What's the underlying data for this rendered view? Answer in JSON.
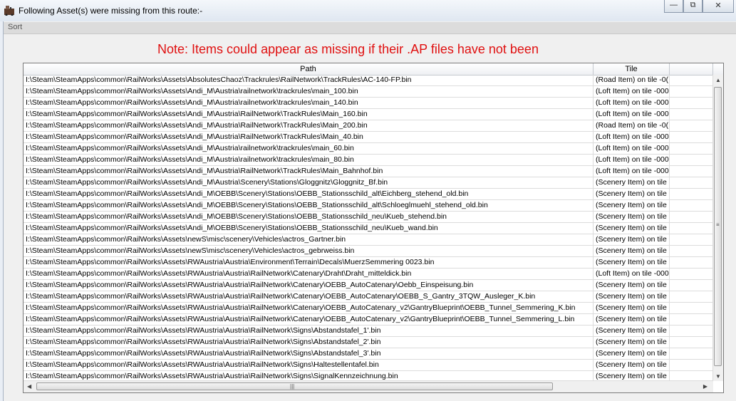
{
  "window": {
    "title": "Following Asset(s) were missing from this route:-",
    "controls": {
      "minimize": "—",
      "maximize": "⧉",
      "close": "✕"
    }
  },
  "menu": {
    "sort_label": "Sort"
  },
  "note": "Note: Items could appear as missing if their .AP files have not been",
  "table": {
    "columns": [
      "Path",
      "Tile",
      ""
    ],
    "rows": [
      {
        "path": "I:\\Steam\\SteamApps\\common\\RailWorks\\Assets\\AbsolutesChaoz\\Trackrules\\RailNetwork\\TrackRules\\AC-140-FP.bin",
        "tile": "(Road Item) on tile -0("
      },
      {
        "path": "I:\\Steam\\SteamApps\\common\\RailWorks\\Assets\\Andi_M\\Austria\\railnetwork\\trackrules\\main_100.bin",
        "tile": "(Loft Item) on tile -000"
      },
      {
        "path": "I:\\Steam\\SteamApps\\common\\RailWorks\\Assets\\Andi_M\\Austria\\railnetwork\\trackrules\\main_140.bin",
        "tile": "(Loft Item) on tile -000"
      },
      {
        "path": "I:\\Steam\\SteamApps\\common\\RailWorks\\Assets\\Andi_M\\Austria\\RailNetwork\\TrackRules\\Main_160.bin",
        "tile": "(Loft Item) on tile -000"
      },
      {
        "path": "I:\\Steam\\SteamApps\\common\\RailWorks\\Assets\\Andi_M\\Austria\\RailNetwork\\TrackRules\\Main_200.bin",
        "tile": "(Road Item) on tile -0("
      },
      {
        "path": "I:\\Steam\\SteamApps\\common\\RailWorks\\Assets\\Andi_M\\Austria\\RailNetwork\\TrackRules\\Main_40.bin",
        "tile": "(Loft Item) on tile -000"
      },
      {
        "path": "I:\\Steam\\SteamApps\\common\\RailWorks\\Assets\\Andi_M\\Austria\\railnetwork\\trackrules\\main_60.bin",
        "tile": "(Loft Item) on tile -000"
      },
      {
        "path": "I:\\Steam\\SteamApps\\common\\RailWorks\\Assets\\Andi_M\\Austria\\railnetwork\\trackrules\\main_80.bin",
        "tile": "(Loft Item) on tile -000"
      },
      {
        "path": "I:\\Steam\\SteamApps\\common\\RailWorks\\Assets\\Andi_M\\Austria\\RailNetwork\\TrackRules\\Main_Bahnhof.bin",
        "tile": "(Loft Item) on tile -000"
      },
      {
        "path": "I:\\Steam\\SteamApps\\common\\RailWorks\\Assets\\Andi_M\\Austria\\Scenery\\Stations\\Gloggnitz\\Gloggnitz_Bf.bin",
        "tile": "(Scenery Item) on tile"
      },
      {
        "path": "I:\\Steam\\SteamApps\\common\\RailWorks\\Assets\\Andi_M\\OEBB\\Scenery\\Stations\\OEBB_Stationsschild_alt\\Eichberg_stehend_old.bin",
        "tile": "(Scenery Item) on tile"
      },
      {
        "path": "I:\\Steam\\SteamApps\\common\\RailWorks\\Assets\\Andi_M\\OEBB\\Scenery\\Stations\\OEBB_Stationsschild_alt\\Schloeglmuehl_stehend_old.bin",
        "tile": "(Scenery Item) on tile"
      },
      {
        "path": "I:\\Steam\\SteamApps\\common\\RailWorks\\Assets\\Andi_M\\OEBB\\Scenery\\Stations\\OEBB_Stationsschild_neu\\Kueb_stehend.bin",
        "tile": "(Scenery Item) on tile"
      },
      {
        "path": "I:\\Steam\\SteamApps\\common\\RailWorks\\Assets\\Andi_M\\OEBB\\Scenery\\Stations\\OEBB_Stationsschild_neu\\Kueb_wand.bin",
        "tile": "(Scenery Item) on tile"
      },
      {
        "path": "I:\\Steam\\SteamApps\\common\\RailWorks\\Assets\\newS\\misc\\scenery\\Vehicles\\actros_Gartner.bin",
        "tile": "(Scenery Item) on tile"
      },
      {
        "path": "I:\\Steam\\SteamApps\\common\\RailWorks\\Assets\\newS\\misc\\scenery\\Vehicles\\actros_gebrweiss.bin",
        "tile": "(Scenery Item) on tile"
      },
      {
        "path": "I:\\Steam\\SteamApps\\common\\RailWorks\\Assets\\RWAustria\\Austria\\Environment\\Terrain\\Decals\\MuerzSemmering 0023.bin",
        "tile": "(Scenery Item) on tile"
      },
      {
        "path": "I:\\Steam\\SteamApps\\common\\RailWorks\\Assets\\RWAustria\\Austria\\RailNetwork\\Catenary\\Draht\\Draht_mitteldick.bin",
        "tile": "(Loft Item) on tile -000"
      },
      {
        "path": "I:\\Steam\\SteamApps\\common\\RailWorks\\Assets\\RWAustria\\Austria\\RailNetwork\\Catenary\\OEBB_AutoCatenary\\Oebb_Einspeisung.bin",
        "tile": "(Scenery Item) on tile"
      },
      {
        "path": "I:\\Steam\\SteamApps\\common\\RailWorks\\Assets\\RWAustria\\Austria\\RailNetwork\\Catenary\\OEBB_AutoCatenary\\OEBB_S_Gantry_3TQW_Ausleger_K.bin",
        "tile": "(Scenery Item) on tile"
      },
      {
        "path": "I:\\Steam\\SteamApps\\common\\RailWorks\\Assets\\RWAustria\\Austria\\RailNetwork\\Catenary\\OEBB_AutoCatenary_v2\\GantryBlueprint\\OEBB_Tunnel_Semmering_K.bin",
        "tile": "(Scenery Item) on tile"
      },
      {
        "path": "I:\\Steam\\SteamApps\\common\\RailWorks\\Assets\\RWAustria\\Austria\\RailNetwork\\Catenary\\OEBB_AutoCatenary_v2\\GantryBlueprint\\OEBB_Tunnel_Semmering_L.bin",
        "tile": "(Scenery Item) on tile"
      },
      {
        "path": "I:\\Steam\\SteamApps\\common\\RailWorks\\Assets\\RWAustria\\Austria\\RailNetwork\\Signs\\Abstandstafel_1'.bin",
        "tile": "(Scenery Item) on tile"
      },
      {
        "path": "I:\\Steam\\SteamApps\\common\\RailWorks\\Assets\\RWAustria\\Austria\\RailNetwork\\Signs\\Abstandstafel_2'.bin",
        "tile": "(Scenery Item) on tile"
      },
      {
        "path": "I:\\Steam\\SteamApps\\common\\RailWorks\\Assets\\RWAustria\\Austria\\RailNetwork\\Signs\\Abstandstafel_3'.bin",
        "tile": "(Scenery Item) on tile"
      },
      {
        "path": "I:\\Steam\\SteamApps\\common\\RailWorks\\Assets\\RWAustria\\Austria\\RailNetwork\\Signs\\Haltestellentafel.bin",
        "tile": "(Scenery Item) on tile"
      },
      {
        "path": "I:\\Steam\\SteamApps\\common\\RailWorks\\Assets\\RWAustria\\Austria\\RailNetwork\\Signs\\SignalKennzeichnung.bin",
        "tile": "(Scenery Item) on tile"
      }
    ]
  },
  "scrollbar": {
    "up": "▲",
    "down": "▼",
    "left": "◀",
    "right": "▶",
    "grip_v": "≡",
    "grip_h": "|||"
  }
}
